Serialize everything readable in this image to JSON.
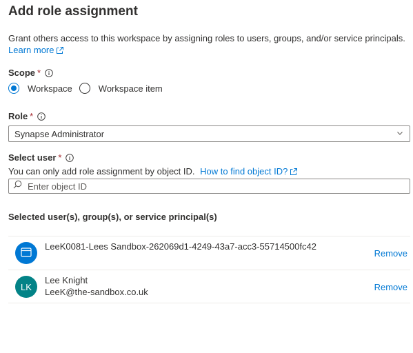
{
  "title": "Add role assignment",
  "description": "Grant others access to this workspace by assigning roles to users, groups, and/or service principals.",
  "learn_more": "Learn more",
  "scope": {
    "label": "Scope",
    "required_mark": "*",
    "options": [
      {
        "label": "Workspace",
        "checked": true
      },
      {
        "label": "Workspace item",
        "checked": false
      }
    ]
  },
  "role": {
    "label": "Role",
    "required_mark": "*",
    "selected": "Synapse Administrator"
  },
  "select_user": {
    "label": "Select user",
    "required_mark": "*",
    "hint": "You can only add role assignment by object ID.",
    "hint_link": "How to find object ID?",
    "placeholder": "Enter object ID"
  },
  "selected_section": {
    "title": "Selected user(s), group(s), or service principal(s)",
    "items": [
      {
        "icon": "app-window-icon",
        "name": "LeeK0081-Lees Sandbox-262069d1-4249-43a7-acc3-55714500fc42",
        "secondary": "",
        "avatar_color": "#0078d4",
        "remove_label": "Remove"
      },
      {
        "initials": "LK",
        "name": "Lee Knight",
        "secondary": "LeeK@the-sandbox.co.uk",
        "avatar_color": "#038387",
        "remove_label": "Remove"
      }
    ]
  }
}
